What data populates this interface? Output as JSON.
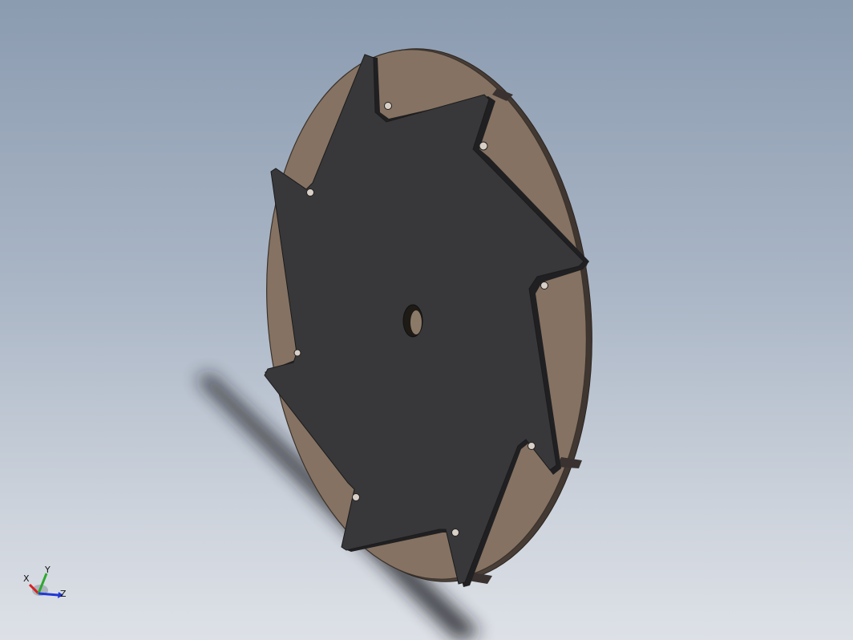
{
  "viewport": {
    "background_top": "#8b9bb0",
    "background_bottom": "#dde1e7"
  },
  "model": {
    "disc_color": "#857262",
    "plate_color": "#38383a",
    "shadow_color": "#1e1e22"
  },
  "triad": {
    "x_label": "X",
    "y_label": "Y",
    "z_label": "Z",
    "x_color": "#d62020",
    "y_color": "#2ea82e",
    "z_color": "#2038d6"
  }
}
